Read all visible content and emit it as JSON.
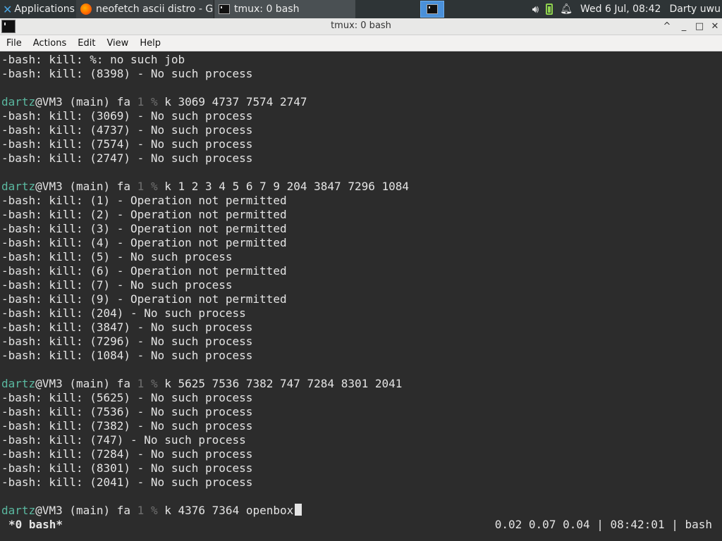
{
  "panel": {
    "applications_label": "Applications",
    "tasks": [
      {
        "label": "neofetch ascii distro - G..."
      },
      {
        "label": "tmux: 0 bash"
      }
    ],
    "clock": "Wed  6 Jul, 08:42",
    "user": "Darty uwu"
  },
  "window": {
    "title": "tmux: 0 bash",
    "buttons": {
      "up": "^",
      "minimize": "_",
      "maximize": "□",
      "close": "✕"
    }
  },
  "menu": [
    "File",
    "Actions",
    "Edit",
    "View",
    "Help"
  ],
  "prompt": {
    "user": "dartz",
    "host_part": "@VM3 (main) fa ",
    "one": "1",
    "pct": "%"
  },
  "terminal_lines": [
    {
      "kind": "out",
      "text": "-bash: kill: %: no such job"
    },
    {
      "kind": "out",
      "text": "-bash: kill: (8398) - No such process"
    },
    {
      "kind": "blank",
      "text": ""
    },
    {
      "kind": "cmd",
      "text": "k 3069 4737 7574 2747"
    },
    {
      "kind": "out",
      "text": "-bash: kill: (3069) - No such process"
    },
    {
      "kind": "out",
      "text": "-bash: kill: (4737) - No such process"
    },
    {
      "kind": "out",
      "text": "-bash: kill: (7574) - No such process"
    },
    {
      "kind": "out",
      "text": "-bash: kill: (2747) - No such process"
    },
    {
      "kind": "blank",
      "text": ""
    },
    {
      "kind": "cmd",
      "text": "k 1 2 3 4 5 6 7 9 204 3847 7296 1084"
    },
    {
      "kind": "out",
      "text": "-bash: kill: (1) - Operation not permitted"
    },
    {
      "kind": "out",
      "text": "-bash: kill: (2) - Operation not permitted"
    },
    {
      "kind": "out",
      "text": "-bash: kill: (3) - Operation not permitted"
    },
    {
      "kind": "out",
      "text": "-bash: kill: (4) - Operation not permitted"
    },
    {
      "kind": "out",
      "text": "-bash: kill: (5) - No such process"
    },
    {
      "kind": "out",
      "text": "-bash: kill: (6) - Operation not permitted"
    },
    {
      "kind": "out",
      "text": "-bash: kill: (7) - No such process"
    },
    {
      "kind": "out",
      "text": "-bash: kill: (9) - Operation not permitted"
    },
    {
      "kind": "out",
      "text": "-bash: kill: (204) - No such process"
    },
    {
      "kind": "out",
      "text": "-bash: kill: (3847) - No such process"
    },
    {
      "kind": "out",
      "text": "-bash: kill: (7296) - No such process"
    },
    {
      "kind": "out",
      "text": "-bash: kill: (1084) - No such process"
    },
    {
      "kind": "blank",
      "text": ""
    },
    {
      "kind": "cmd",
      "text": "k 5625 7536 7382 747 7284 8301 2041"
    },
    {
      "kind": "out",
      "text": "-bash: kill: (5625) - No such process"
    },
    {
      "kind": "out",
      "text": "-bash: kill: (7536) - No such process"
    },
    {
      "kind": "out",
      "text": "-bash: kill: (7382) - No such process"
    },
    {
      "kind": "out",
      "text": "-bash: kill: (747) - No such process"
    },
    {
      "kind": "out",
      "text": "-bash: kill: (7284) - No such process"
    },
    {
      "kind": "out",
      "text": "-bash: kill: (8301) - No such process"
    },
    {
      "kind": "out",
      "text": "-bash: kill: (2041) - No such process"
    },
    {
      "kind": "blank",
      "text": ""
    },
    {
      "kind": "cmd",
      "text": "k 4376 7364 openbox",
      "cursor": true
    }
  ],
  "tmux_status": {
    "window": "*0 bash*",
    "right": "0.02 0.07 0.04 | 08:42:01 | bash"
  },
  "colors": {
    "terminal_bg": "#2c2c2c",
    "prompt_user": "#5ab8a0",
    "prompt_dim": "#707070",
    "panel_bg": "#2e3436",
    "accent": "#4a90d9"
  },
  "icons": [
    "applications-icon",
    "firefox-icon",
    "terminal-icon",
    "volume-icon",
    "battery-icon",
    "notification-bell-icon"
  ]
}
